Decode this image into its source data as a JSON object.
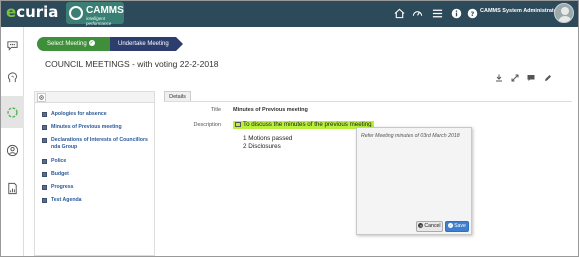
{
  "brand": {
    "ecuria_first": "e",
    "ecuria_rest": "curia",
    "camms_title": "CAMMS",
    "camms_sub": "intelligent performance"
  },
  "header": {
    "user_name": "CAMMS System Administrator",
    "icons": [
      "home-icon",
      "dashboard-icon",
      "menu-icon",
      "info-icon",
      "help-icon"
    ]
  },
  "leftnav": {
    "icons": [
      "chat-icon",
      "brain-icon",
      "cycle-icon",
      "user-circle-icon",
      "report-icon"
    ]
  },
  "breadcrumb": {
    "step1": "Select Meeting",
    "step2": "Undertake Meeting"
  },
  "page": {
    "title": "COUNCIL MEETINGS - with voting 22-2-2018"
  },
  "toolbar": {
    "icons": [
      "download-icon",
      "expand-icon",
      "comment-icon",
      "edit-icon"
    ]
  },
  "agenda": {
    "items": [
      "Apologies for absence",
      "Minutes of Previous meeting",
      "Declarations of Interests of Councillors nda Group",
      "Police",
      "Budget",
      "Progress",
      "Test Agenda"
    ]
  },
  "details": {
    "tab_label": "Details",
    "title_label": "Title",
    "title_value": "Minutes of Previous meeting",
    "description_label": "Description",
    "description_line": "To discuss the minutes of the previous meeting",
    "list": [
      "1  Motions passed",
      "2  Disclosures"
    ]
  },
  "popup": {
    "text": "Refer Meeting minutes of 03rd March 2018",
    "cancel_label": "Cancel",
    "save_label": "Save"
  },
  "colors": {
    "topbar": "#2c4a5a",
    "accent_green": "#3f8f3a",
    "accent_navy": "#2d3e6e",
    "highlight": "#b8f03a",
    "save_blue": "#3f7fcf"
  }
}
